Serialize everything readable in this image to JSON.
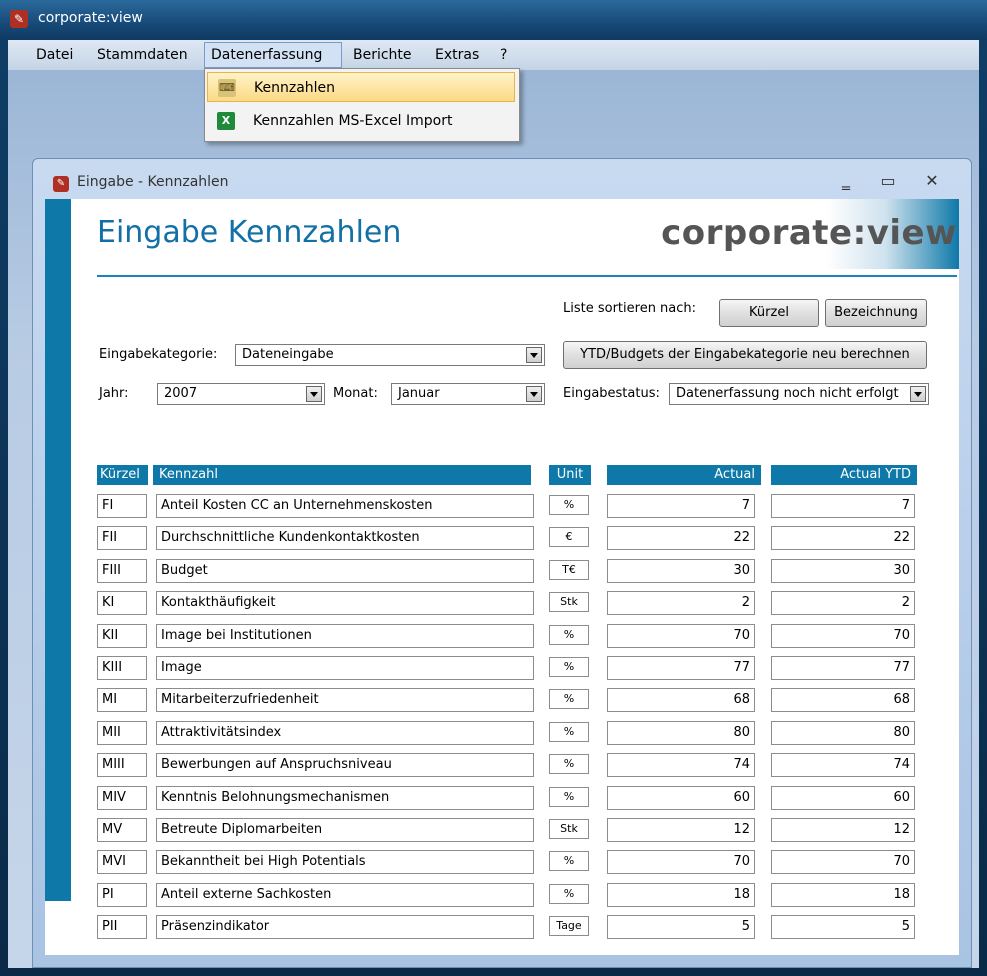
{
  "app": {
    "title": "corporate:view"
  },
  "menubar": [
    {
      "label": "Datei"
    },
    {
      "label": "Stammdaten"
    },
    {
      "label": "Datenerfassung"
    },
    {
      "label": "Berichte"
    },
    {
      "label": "Extras"
    },
    {
      "label": "?"
    }
  ],
  "dropdown": {
    "items": [
      {
        "label": "Kennzahlen",
        "icon": "keyboard-icon"
      },
      {
        "label": "Kennzahlen MS-Excel Import",
        "icon": "excel-icon"
      }
    ]
  },
  "child": {
    "title": "Eingabe - Kennzahlen",
    "heading": "Eingabe Kennzahlen",
    "logo": "corporate:view",
    "sort_label": "Liste sortieren nach:",
    "sort_kuerzel": "Kürzel",
    "sort_bezeichnung": "Bezeichnung",
    "category_label": "Eingabekategorie:",
    "category_value": "Dateneingabe",
    "recalc_button": "YTD/Budgets der Eingabekategorie neu berechnen",
    "year_label": "Jahr:",
    "year_value": "2007",
    "month_label": "Monat:",
    "month_value": "Januar",
    "status_label": "Eingabestatus:",
    "status_value": "Datenerfassung noch nicht erfolgt"
  },
  "table": {
    "headers": {
      "kuerzel": "Kürzel",
      "kennzahl": "Kennzahl",
      "unit": "Unit",
      "actual": "Actual",
      "ytd": "Actual YTD"
    },
    "rows": [
      {
        "k": "FI",
        "name": "Anteil Kosten CC an Unternehmenskosten",
        "unit": "%",
        "actual": "7",
        "ytd": "7"
      },
      {
        "k": "FII",
        "name": "Durchschnittliche Kundenkontaktkosten",
        "unit": "€",
        "actual": "22",
        "ytd": "22"
      },
      {
        "k": "FIII",
        "name": "Budget",
        "unit": "T€",
        "actual": "30",
        "ytd": "30"
      },
      {
        "k": "KI",
        "name": "Kontakthäufigkeit",
        "unit": "Stk",
        "actual": "2",
        "ytd": "2"
      },
      {
        "k": "KII",
        "name": "Image bei Institutionen",
        "unit": "%",
        "actual": "70",
        "ytd": "70"
      },
      {
        "k": "KIII",
        "name": "Image",
        "unit": "%",
        "actual": "77",
        "ytd": "77"
      },
      {
        "k": "MI",
        "name": "Mitarbeiterzufriedenheit",
        "unit": "%",
        "actual": "68",
        "ytd": "68"
      },
      {
        "k": "MII",
        "name": "Attraktivitätsindex",
        "unit": "%",
        "actual": "80",
        "ytd": "80"
      },
      {
        "k": "MIII",
        "name": "Bewerbungen auf Anspruchsniveau",
        "unit": "%",
        "actual": "74",
        "ytd": "74"
      },
      {
        "k": "MIV",
        "name": "Kenntnis Belohnungsmechanismen",
        "unit": "%",
        "actual": "60",
        "ytd": "60"
      },
      {
        "k": "MV",
        "name": "Betreute Diplomarbeiten",
        "unit": "Stk",
        "actual": "12",
        "ytd": "12"
      },
      {
        "k": "MVI",
        "name": "Bekanntheit bei High Potentials",
        "unit": "%",
        "actual": "70",
        "ytd": "70"
      },
      {
        "k": "PI",
        "name": "Anteil externe Sachkosten",
        "unit": "%",
        "actual": "18",
        "ytd": "18"
      },
      {
        "k": "PII",
        "name": "Präsenzindikator",
        "unit": "Tage",
        "actual": "5",
        "ytd": "5"
      }
    ]
  }
}
